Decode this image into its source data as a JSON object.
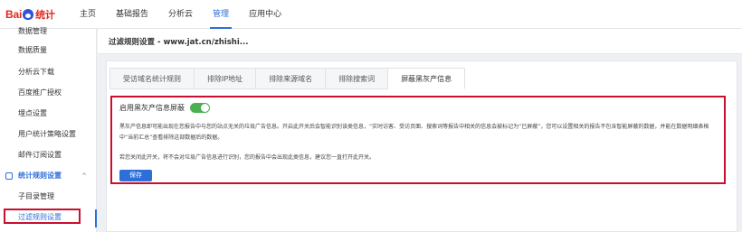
{
  "logo": {
    "brand_latin": "Bai",
    "brand_cn": "统计"
  },
  "topnav": {
    "items": [
      {
        "label": "主页"
      },
      {
        "label": "基础报告"
      },
      {
        "label": "分析云"
      },
      {
        "label": "管理",
        "active": true
      },
      {
        "label": "应用中心"
      }
    ]
  },
  "sidebar": {
    "items": [
      {
        "label": "数据管理"
      },
      {
        "label": "数据质量"
      },
      {
        "label": "分析云下载"
      },
      {
        "label": "百度推广授权"
      },
      {
        "label": "埋点设置"
      },
      {
        "label": "用户统计策略设置"
      },
      {
        "label": "邮件订阅设置"
      }
    ],
    "group": {
      "label": "统计规则设置",
      "chevron": "^"
    },
    "sub_items": [
      {
        "label": "子目录管理"
      },
      {
        "label": "过滤规则设置",
        "selected": true
      }
    ]
  },
  "page": {
    "title": "过滤规则设置 - www.jat.cn/zhishi..."
  },
  "tabs": [
    {
      "label": "受访域名统计规则"
    },
    {
      "label": "排除IP地址"
    },
    {
      "label": "排除来源域名"
    },
    {
      "label": "排除搜索词"
    },
    {
      "label": "屏蔽黑灰产信息",
      "active": true
    }
  ],
  "content": {
    "toggle_label": "启用黑灰产信息屏蔽",
    "toggle_on": true,
    "description": "黑灰产信息即可能出现在您报告中与您的站点无关的垃圾广告信息。开启此开关后会智能识别该类信息，“实时访客、受访页面、搜索词等报告中相关的信息会被标记为“已屏蔽”，您可以设置相关的报告不包含智能屏蔽的数据，并能在数据明细表格中“当前汇总”查看排除这部数据后的数据。",
    "note": "若您关闭此开关，将不会对垃圾广告信息进行识别，您的报告中会出现此类信息，建议您一直打开此开关。",
    "save_label": "保存"
  },
  "colors": {
    "accent": "#2d6fd8",
    "highlight_red": "#c8102e",
    "toggle_green": "#4caf50"
  }
}
